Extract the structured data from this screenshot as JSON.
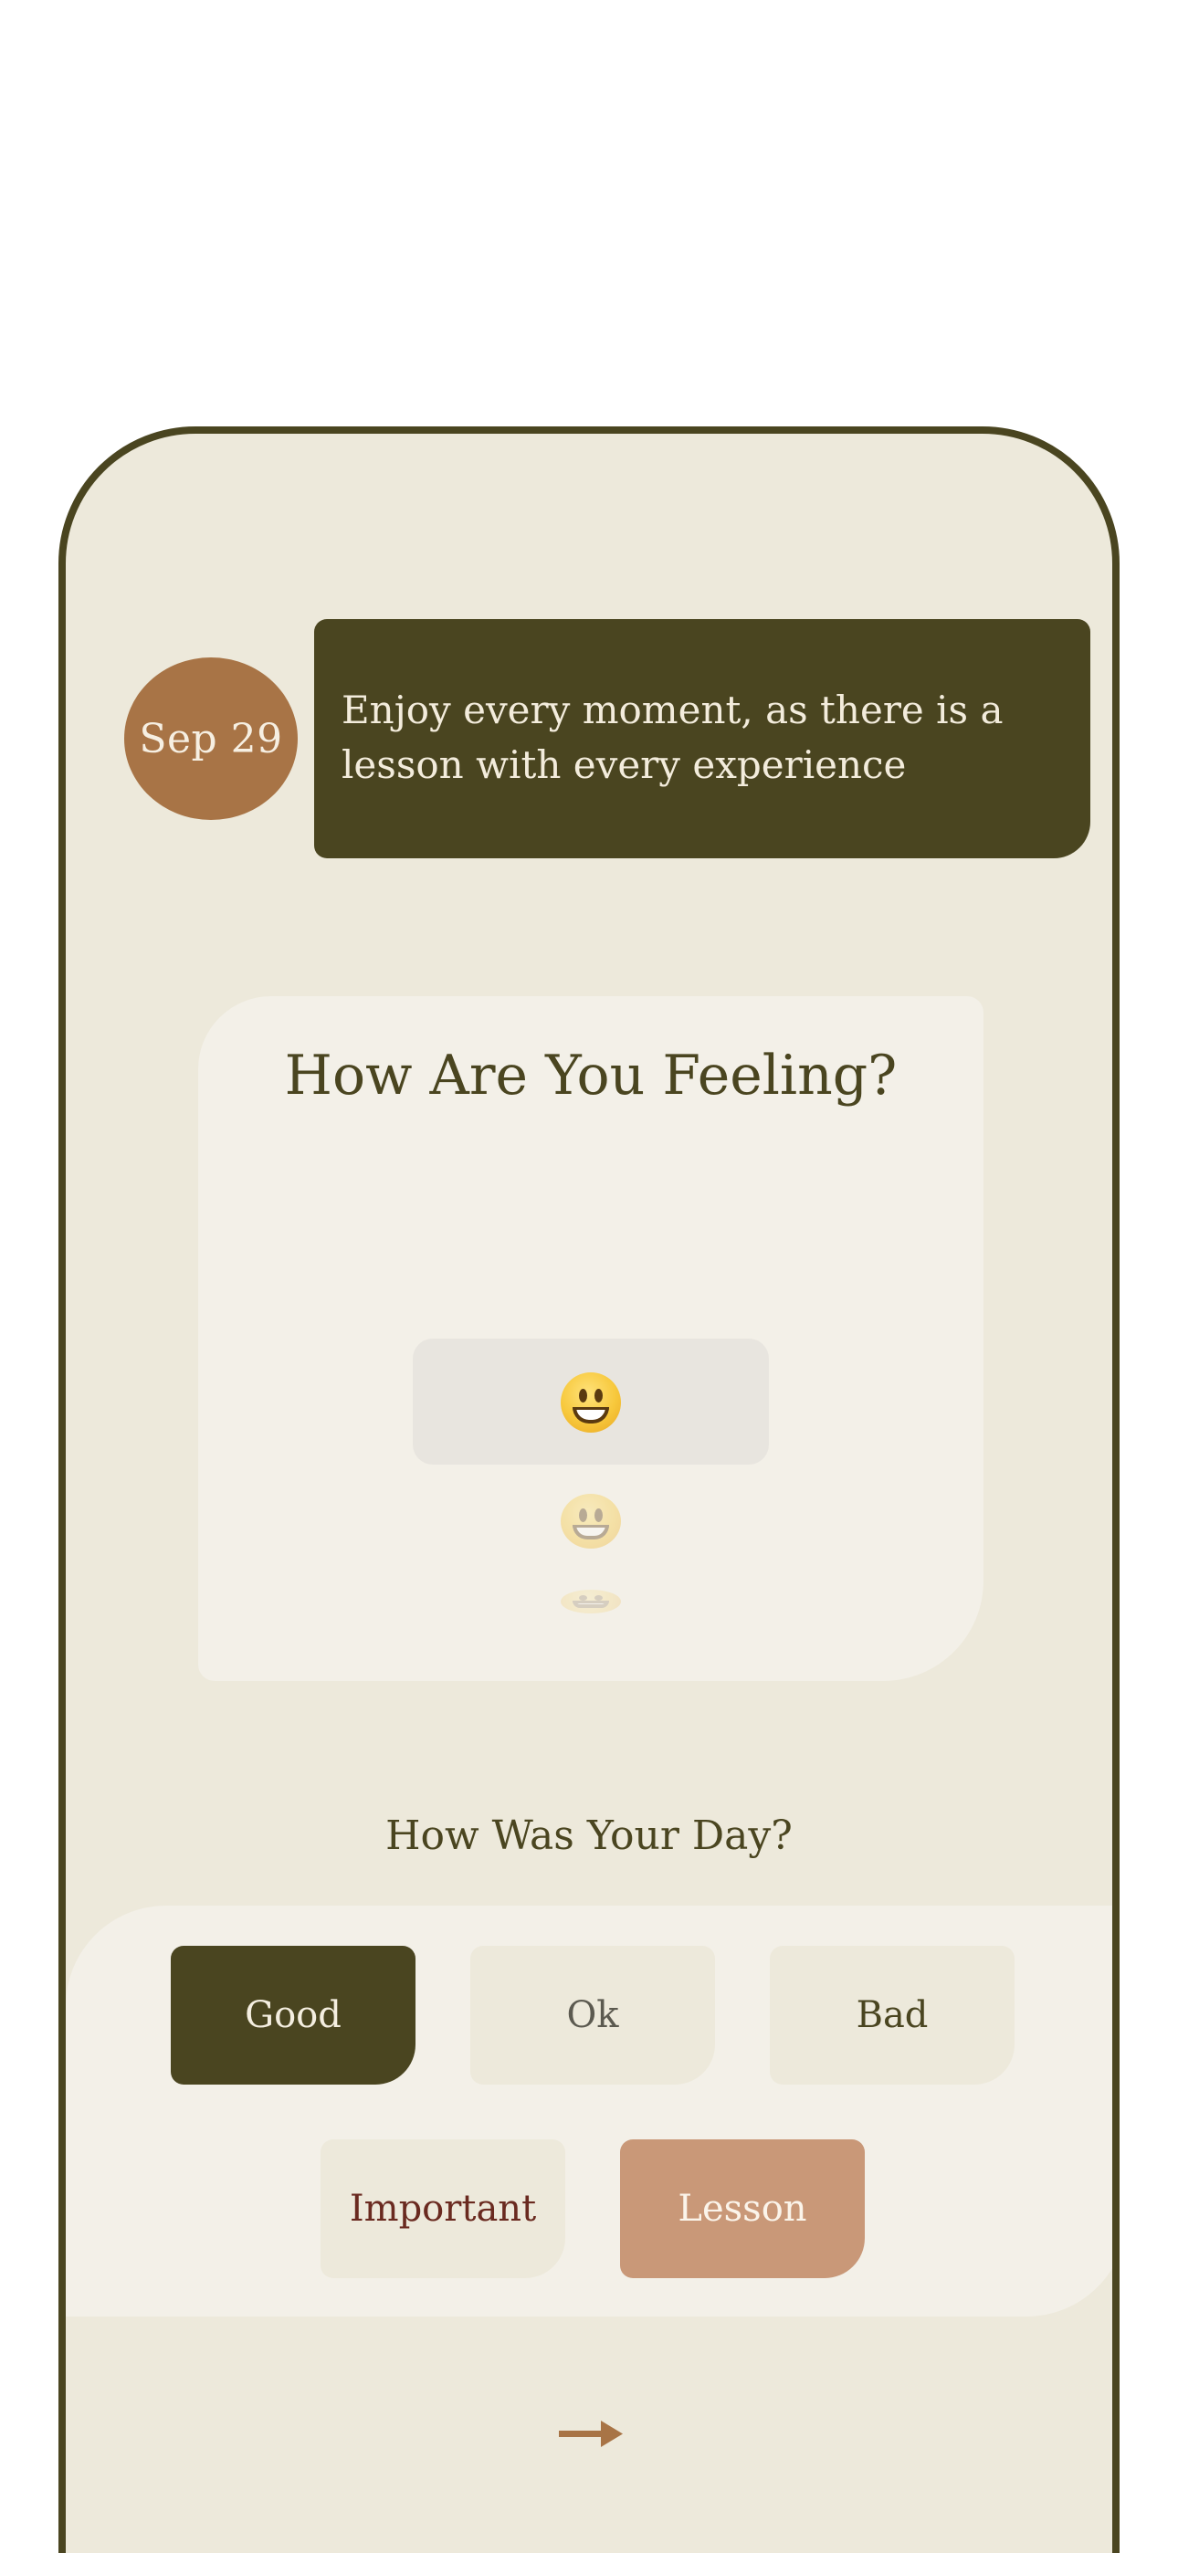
{
  "entry": {
    "date": "Sep 29",
    "quote": "Enjoy every moment, as there is a lesson with every experience"
  },
  "feeling": {
    "title": "How Are You Feeling?",
    "picker_options": [
      "grinning-face",
      "grinning-face",
      "grinning-face"
    ],
    "selected": "grinning-face"
  },
  "day": {
    "title": "How Was Your Day?",
    "options": [
      "Good",
      "Ok",
      "Bad",
      "Important",
      "Lesson"
    ],
    "selected": [
      "Good",
      "Lesson"
    ]
  },
  "navigation": {
    "next_icon": "arrow-right-icon"
  },
  "colors": {
    "frame": "#4a4520",
    "background": "#ede9db",
    "card": "#f3f0e8",
    "date_badge": "#a87446",
    "quote_bubble": "#4a4520",
    "selected_good": "#4a4520",
    "selected_lesson": "#c99878",
    "arrow": "#a87446"
  }
}
